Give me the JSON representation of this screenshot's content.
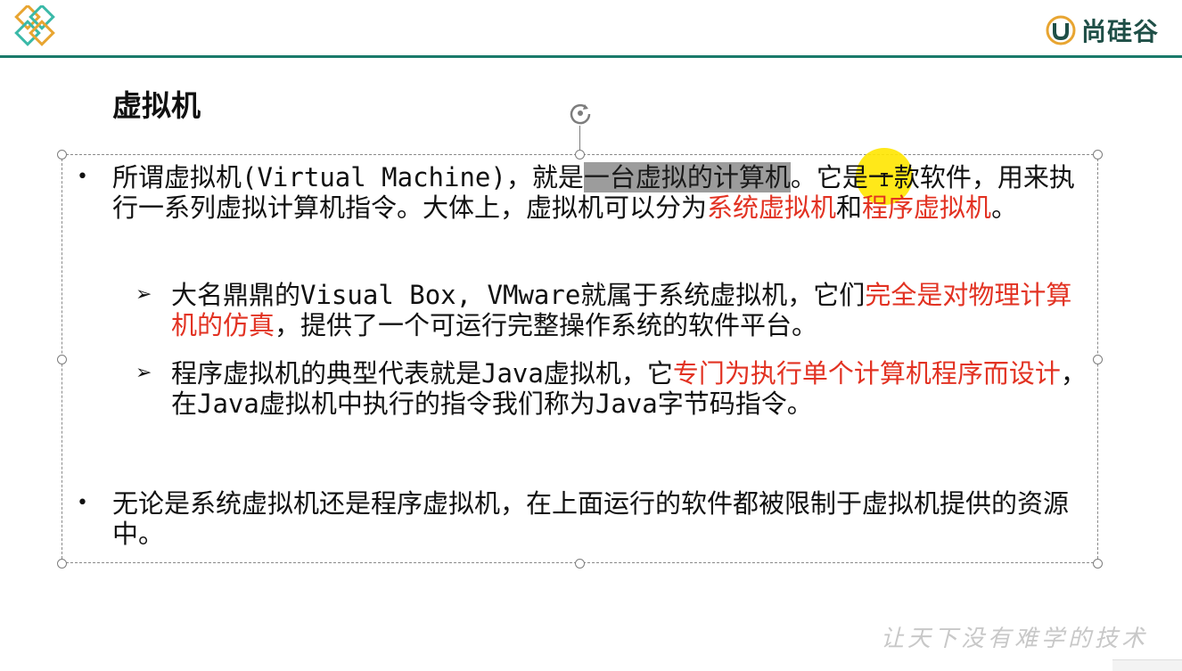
{
  "header": {
    "brand_text": "尚硅谷",
    "accent_color": "#1a7a6a",
    "logo_icon": "diamond-lattice-logo"
  },
  "slide": {
    "title": "虚拟机",
    "bullets": [
      {
        "parts": [
          {
            "t": "所谓虚拟机",
            "s": ""
          },
          {
            "t": "(Virtual Machine)",
            "s": "mono"
          },
          {
            "t": "，就是",
            "s": ""
          },
          {
            "t": "一台虚拟的计算机",
            "s": "hl"
          },
          {
            "t": "。它是一款软件，用来执行一系列虚拟计算机指令。大体上，虚拟机可以分为",
            "s": ""
          },
          {
            "t": "系统虚拟机",
            "s": "red"
          },
          {
            "t": "和",
            "s": ""
          },
          {
            "t": "程序虚拟机",
            "s": "red"
          },
          {
            "t": "。",
            "s": ""
          }
        ]
      },
      {
        "parts": [
          {
            "t": "无论是系统虚拟机还是程序虚拟机，在上面运行的软件都被限制于虚拟机提供的资源中。",
            "s": ""
          }
        ]
      }
    ],
    "subbullets": [
      {
        "parts": [
          {
            "t": "大名鼎鼎的",
            "s": ""
          },
          {
            "t": "Visual Box, VMware",
            "s": "mono"
          },
          {
            "t": "就属于系统虚拟机，它们",
            "s": ""
          },
          {
            "t": "完全是对物理计算机的仿真",
            "s": "red"
          },
          {
            "t": "，提供了一个可运行完整操作系统的软件平台。",
            "s": ""
          }
        ]
      },
      {
        "parts": [
          {
            "t": "程序虚拟机的典型代表就是",
            "s": ""
          },
          {
            "t": "Java",
            "s": "mono"
          },
          {
            "t": "虚拟机，它",
            "s": ""
          },
          {
            "t": "专门为执行单个计算机程序而设计",
            "s": "red"
          },
          {
            "t": "，在",
            "s": ""
          },
          {
            "t": "Java",
            "s": "mono"
          },
          {
            "t": "虚拟机中执行的指令我们称为",
            "s": ""
          },
          {
            "t": "Java",
            "s": "mono"
          },
          {
            "t": "字节码指令。",
            "s": ""
          }
        ]
      }
    ],
    "slogan": "让天下没有难学的技术"
  },
  "colors": {
    "highlight_red": "#e23222",
    "selection_gray": "#9c9c9c",
    "cursor_yellow": "#ffe600"
  }
}
